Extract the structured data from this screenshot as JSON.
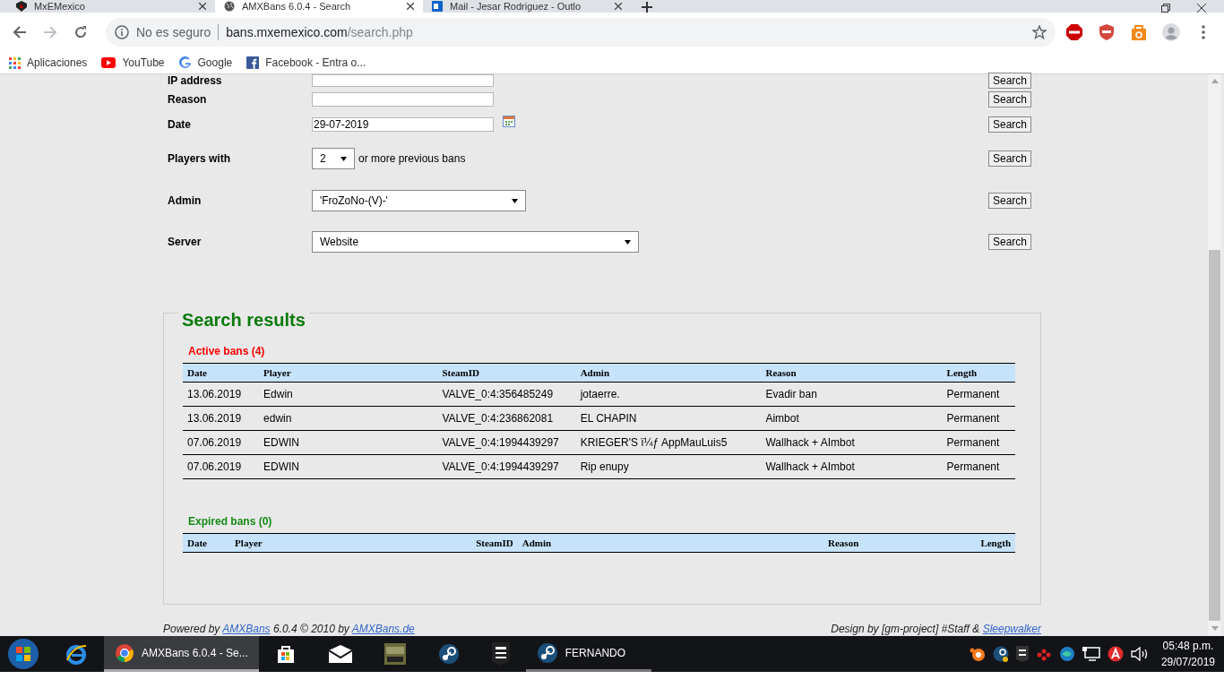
{
  "browser": {
    "tabs": [
      {
        "kind": "shield",
        "title": "MxEMexico",
        "selected": false
      },
      {
        "kind": "globe",
        "title": "AMXBans 6.0.4 - Search",
        "selected": true
      },
      {
        "kind": "mail",
        "title": "Mail - Jesar Rodriguez - Outlo",
        "selected": false
      }
    ],
    "security": "No es seguro",
    "url_host": "bans.mxemexico.com",
    "url_path": "/search.php",
    "bookmarks": [
      {
        "kind": "apps",
        "label": "Aplicaciones"
      },
      {
        "kind": "youtube",
        "label": "YouTube"
      },
      {
        "kind": "google",
        "label": "Google"
      },
      {
        "kind": "facebook",
        "label": "Facebook - Entra o..."
      }
    ]
  },
  "search_form": {
    "rows": [
      {
        "kind": "text",
        "label": "IP address",
        "button": "Search"
      },
      {
        "kind": "text",
        "label": "Reason",
        "button": "Search"
      },
      {
        "kind": "date",
        "label": "Date",
        "value": "29-07-2019",
        "button": "Search"
      },
      {
        "kind": "count",
        "label": "Players with",
        "value": "2",
        "suffix": "or more previous bans",
        "button": "Search"
      },
      {
        "kind": "select",
        "label": "Admin",
        "value": "'FroZoNo-(V)-'",
        "button": "Search"
      },
      {
        "kind": "select",
        "label": "Server",
        "value": "Website",
        "button": "Search"
      }
    ]
  },
  "results": {
    "title": "Search results",
    "sections": [
      {
        "kind": "active",
        "heading": "Active bans (4)",
        "columns": [
          "Date",
          "Player",
          "SteamID",
          "Admin",
          "Reason",
          "Length"
        ],
        "rows": [
          [
            "13.06.2019",
            "Edwin",
            "VALVE_0:4:356485249",
            "jotaerre.",
            "Evadir ban",
            "Permanent"
          ],
          [
            "13.06.2019",
            "edwin",
            "VALVE_0:4:236862081",
            "EL CHAPIN",
            "Aimbot",
            "Permanent"
          ],
          [
            "07.06.2019",
            "EDWIN",
            "VALVE_0:4:1994439297",
            "KRIEGER'S ï¼ƒ AppMauLuis5",
            "Wallhack + AImbot",
            "Permanent"
          ],
          [
            "07.06.2019",
            "EDWIN",
            "VALVE_0:4:1994439297",
            "Rip enupy",
            "Wallhack + AImbot",
            "Permanent"
          ]
        ]
      },
      {
        "kind": "expired",
        "heading": "Expired bans (0)",
        "columns": [
          "Date",
          "Player",
          "SteamID",
          "Admin",
          "Reason",
          "Length"
        ]
      }
    ]
  },
  "footer": {
    "left": [
      {
        "text": "Powered by "
      },
      {
        "link": "AMXBans"
      },
      {
        "text": " 6.0.4 © 2010 by "
      },
      {
        "link": "AMXBans.de"
      }
    ],
    "right": [
      {
        "text": "Design by [gm-project] #Staff & "
      },
      {
        "link": "Sleepwalker"
      }
    ]
  },
  "taskbar": {
    "apps": [
      {
        "kind": "ie",
        "active": false
      },
      {
        "kind": "chrome",
        "label": "AMXBans 6.0.4 - Se...",
        "active": true
      },
      {
        "kind": "store",
        "active": false
      },
      {
        "kind": "mail",
        "active": false
      },
      {
        "kind": "game",
        "active": false
      },
      {
        "kind": "steam",
        "active": false
      },
      {
        "kind": "epic",
        "active": false
      },
      {
        "kind": "steam",
        "label": "FERNANDO",
        "active": false
      }
    ],
    "time": "05:48 p.m.",
    "date": "29/07/2019"
  }
}
